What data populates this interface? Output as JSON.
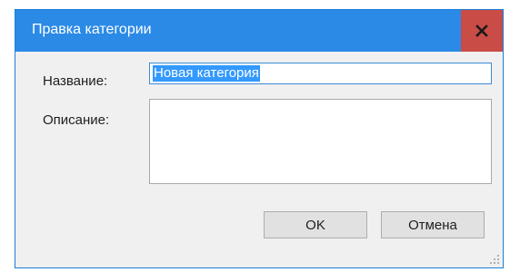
{
  "window": {
    "title": "Правка категории",
    "close_label": "x"
  },
  "form": {
    "name_label": "Название:",
    "name_value": "Новая категория",
    "description_label": "Описание:",
    "description_value": ""
  },
  "buttons": {
    "ok_label": "OK",
    "cancel_label": "Отмена"
  },
  "colors": {
    "titlebar": "#2b8ae6",
    "close": "#c94c47",
    "selection": "#3399ff"
  }
}
